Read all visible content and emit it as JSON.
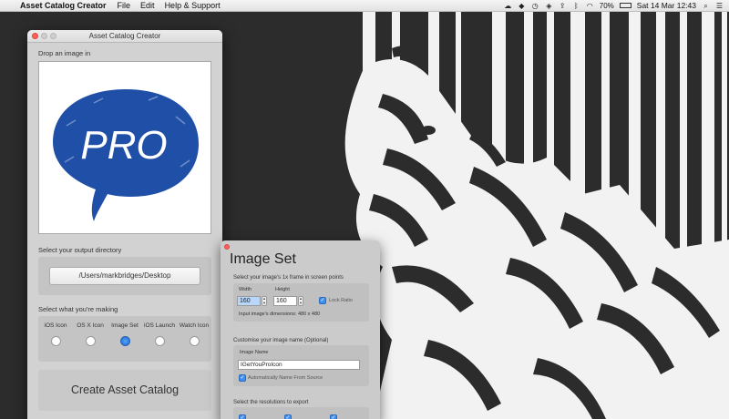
{
  "menubar": {
    "apple_symbol": "",
    "app_name": "Asset Catalog Creator",
    "menus": [
      "File",
      "Edit",
      "Help & Support"
    ],
    "battery": "70%",
    "datetime": "Sat 14 Mar  12:43"
  },
  "window": {
    "title": "Asset Catalog Creator",
    "drop_label": "Drop an image in",
    "logo_text": "PRO",
    "output_label": "Select your output directory",
    "output_path": "/Users/markbridges/Desktop",
    "making_label": "Select what you're making",
    "types": [
      {
        "label": "iOS Icon",
        "selected": false
      },
      {
        "label": "OS X Icon",
        "selected": false
      },
      {
        "label": "Image Set",
        "selected": true
      },
      {
        "label": "iOS Launch",
        "selected": false
      },
      {
        "label": "Watch Icon",
        "selected": false
      }
    ],
    "create_button": "Create Asset Catalog"
  },
  "panel": {
    "title": "Image Set",
    "frame_label": "Select your image's 1x frame in screen points",
    "width_label": "Width",
    "height_label": "Height",
    "width_value": "160",
    "height_value": "160",
    "lock_ratio_label": "Lock Ratio",
    "dimensions_text": "Input image's dimensions: 480 x 480",
    "name_label": "Customise your image name (Optional)",
    "image_name_label": "Image Name",
    "image_name_value": "IGetYouProIcon",
    "auto_name_label": "Automatically Name From Source",
    "resolutions_label": "Select the resolutions to export"
  },
  "colors": {
    "accent": "#3d8ff0",
    "logo_blue": "#1f4fa6",
    "close_red": "#fc605c",
    "wallpaper_dark": "#2c2c2c"
  }
}
